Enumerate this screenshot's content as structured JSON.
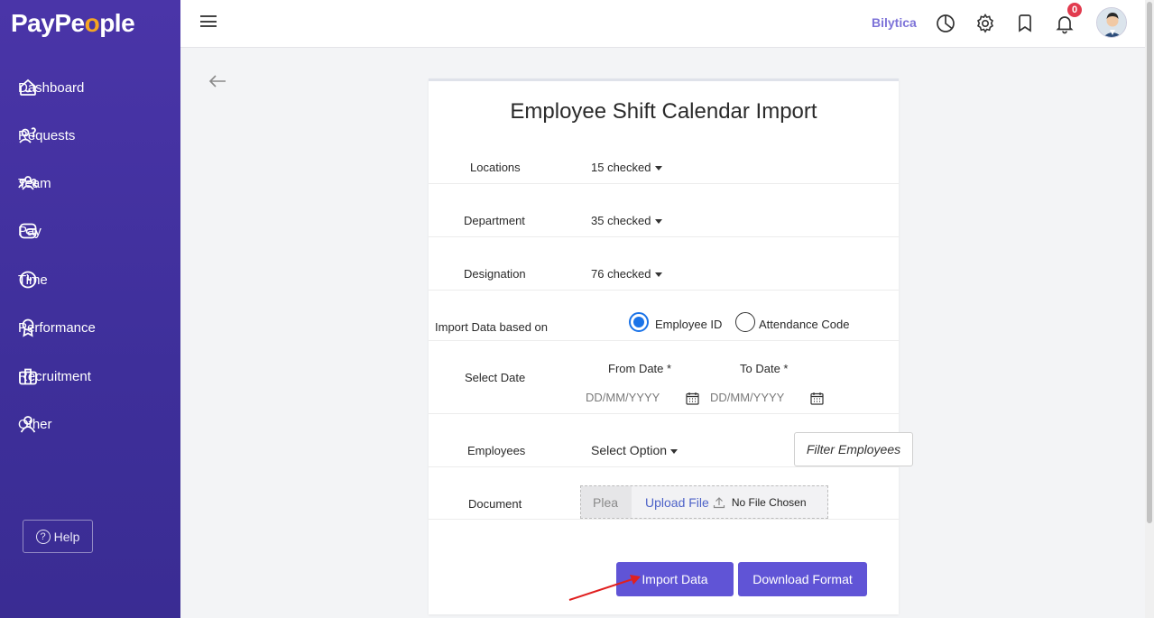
{
  "brand": {
    "logo_pre": "PayPe",
    "logo_o": "o",
    "logo_post": "ple"
  },
  "sidebar": {
    "items": [
      {
        "label": "Dashboard",
        "icon": "home-icon"
      },
      {
        "label": "Requests",
        "icon": "requests-icon"
      },
      {
        "label": "Team",
        "icon": "team-icon"
      },
      {
        "label": "Pay",
        "icon": "wallet-icon"
      },
      {
        "label": "Time",
        "icon": "clock-icon"
      },
      {
        "label": "Performance",
        "icon": "award-icon"
      },
      {
        "label": "Recruitment",
        "icon": "briefcase-icon"
      },
      {
        "label": "Other",
        "icon": "user-icon"
      }
    ],
    "help_label": "Help"
  },
  "topbar": {
    "company": "Bilytica",
    "notification_count": "0"
  },
  "form": {
    "title": "Employee Shift Calendar Import",
    "locations": {
      "label": "Locations",
      "value": "15 checked"
    },
    "department": {
      "label": "Department",
      "value": "35 checked"
    },
    "designation": {
      "label": "Designation",
      "value": "76 checked"
    },
    "import_based_on": {
      "label": "Import Data based on",
      "options": [
        "Employee ID",
        "Attendance Code"
      ],
      "selected": "Employee ID"
    },
    "select_date": {
      "label": "Select Date",
      "from_label": "From Date *",
      "to_label": "To Date *",
      "from_placeholder": "DD/MM/YYYY",
      "to_placeholder": "DD/MM/YYYY"
    },
    "employees": {
      "label": "Employees",
      "value": "Select Option",
      "filter_button": "Filter Employees"
    },
    "document": {
      "label": "Document",
      "placeholder": "Plea",
      "upload_label": "Upload File",
      "file_status": "No File Chosen"
    },
    "buttons": {
      "import": "Import Data",
      "download": "Download Format"
    }
  },
  "colors": {
    "sidebar": "#4a35a8",
    "primary": "#6054d6",
    "accent": "#7d73d8",
    "radio": "#1a73e8",
    "badge": "#e23b4e",
    "annotation_arrow": "#e02020"
  }
}
